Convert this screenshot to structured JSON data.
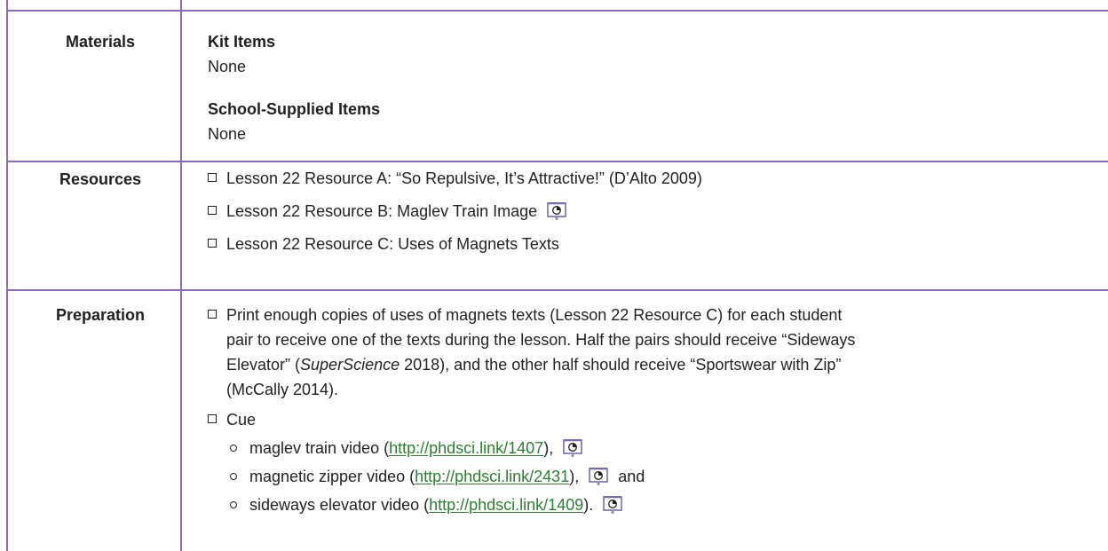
{
  "materials": {
    "label": "Materials",
    "kit_heading": "Kit Items",
    "kit_value": "None",
    "school_heading": "School-Supplied Items",
    "school_value": "None"
  },
  "resources": {
    "label": "Resources",
    "items": [
      "Lesson 22 Resource A: “So Repulsive, It’s Attractive!” (D’Alto 2009)",
      "Lesson 22 Resource B: Maglev Train Image",
      "Lesson 22 Resource C: Uses of Magnets Texts"
    ]
  },
  "preparation": {
    "label": "Preparation",
    "item1": {
      "line1": "Print enough copies of uses of magnets texts (Lesson 22 Resource C) for each student",
      "line2": "pair to receive one of the texts during the lesson. Half the pairs should receive “Sideways",
      "line3a": "Elevator” (",
      "line3_italic": "SuperScience",
      "line3b": " 2018), and the other half should receive “Sportswear with Zip”",
      "line4": "(McCally 2014)."
    },
    "item2": "Cue",
    "cue_items": [
      {
        "pre": "maglev train video (",
        "link": "http://phdsci.link/1407",
        "post": "),",
        "after": ""
      },
      {
        "pre": "magnetic zipper video (",
        "link": "http://phdsci.link/2431",
        "post": "),",
        "after": "and"
      },
      {
        "pre": "sideways elevator video (",
        "link": "http://phdsci.link/1409",
        "post": ").",
        "after": ""
      }
    ]
  },
  "colors": {
    "border": "#8b6bb1",
    "link": "#2e7d32",
    "text": "#231f20"
  },
  "icons": {
    "checkbox": "checkbox-icon",
    "projector": "projector-screen-icon",
    "bullet": "circle-bullet-icon"
  }
}
